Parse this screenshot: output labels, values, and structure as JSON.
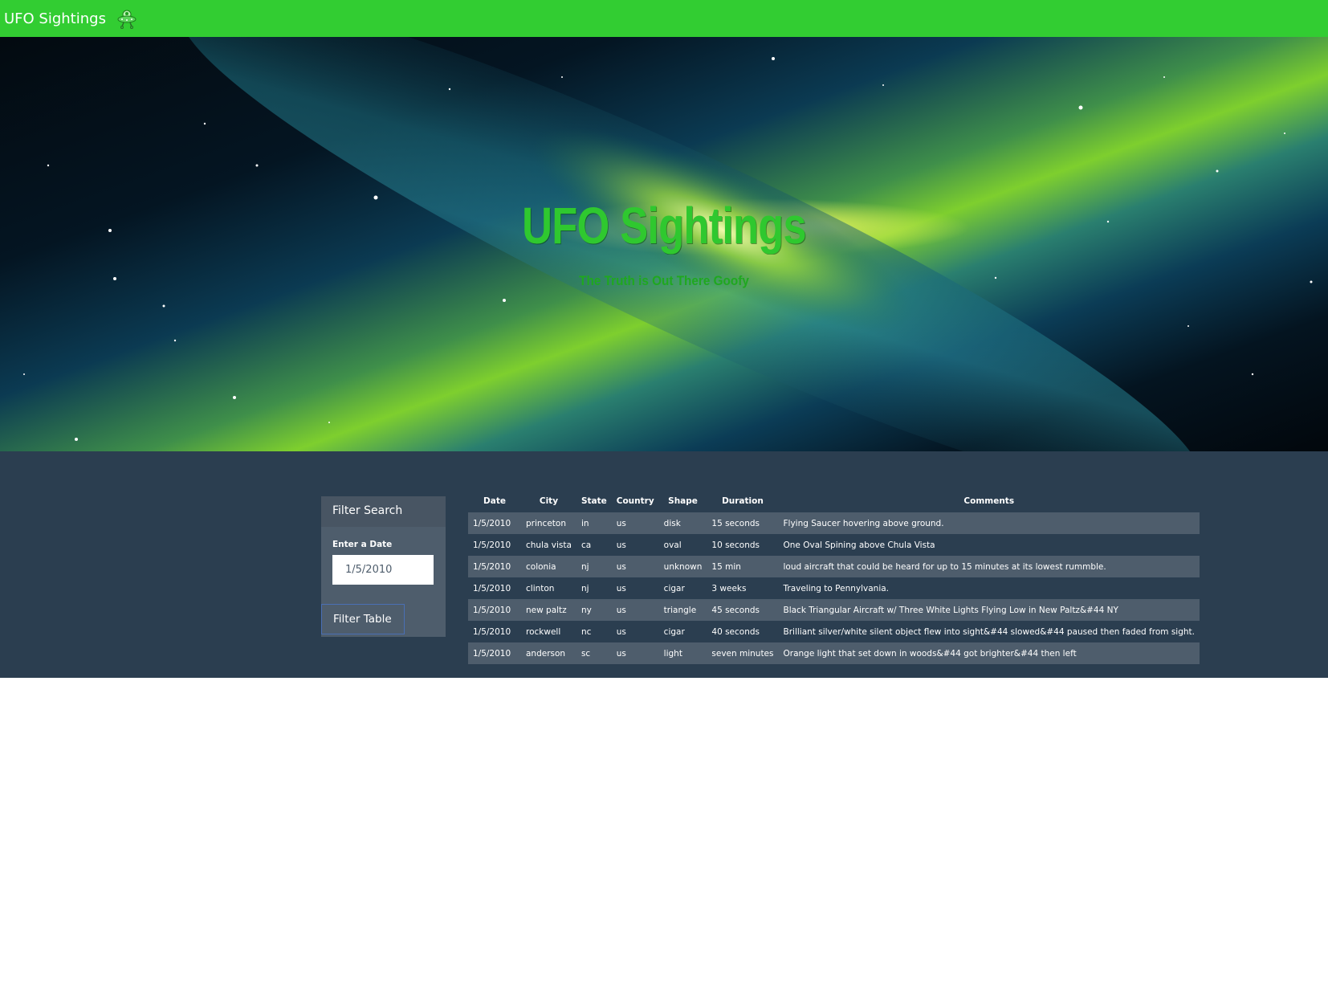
{
  "navbar": {
    "brand": "UFO Sightings",
    "brand_icon": "ufo-icon"
  },
  "hero": {
    "title": "UFO Sightings",
    "subtitle": "The Truth is Out There Goofy"
  },
  "filter": {
    "heading": "Filter Search",
    "date_label": "Enter a Date",
    "date_value": "1/5/2010",
    "button_label": "Filter Table"
  },
  "table": {
    "headers": [
      "Date",
      "City",
      "State",
      "Country",
      "Shape",
      "Duration",
      "Comments"
    ],
    "rows": [
      [
        "1/5/2010",
        "princeton",
        "in",
        "us",
        "disk",
        "15 seconds",
        "Flying Saucer hovering above ground."
      ],
      [
        "1/5/2010",
        "chula vista",
        "ca",
        "us",
        "oval",
        "10 seconds",
        "One Oval Spining above Chula Vista"
      ],
      [
        "1/5/2010",
        "colonia",
        "nj",
        "us",
        "unknown",
        "15 min",
        "loud aircraft that could be heard for up to 15 minutes at its lowest rummble."
      ],
      [
        "1/5/2010",
        "clinton",
        "nj",
        "us",
        "cigar",
        "3 weeks",
        "Traveling to Pennylvania."
      ],
      [
        "1/5/2010",
        "new paltz",
        "ny",
        "us",
        "triangle",
        "45 seconds",
        "Black Triangular Aircraft w/ Three White Lights Flying Low in New Paltz&#44 NY"
      ],
      [
        "1/5/2010",
        "rockwell",
        "nc",
        "us",
        "cigar",
        "40 seconds",
        "Brilliant silver/white silent object flew into sight&#44 slowed&#44 paused then faded from sight."
      ],
      [
        "1/5/2010",
        "anderson",
        "sc",
        "us",
        "light",
        "seven minutes",
        "Orange light that set down in woods&#44 got brighter&#44 then left"
      ]
    ]
  },
  "colors": {
    "navbar": "#32cd32",
    "content_bg": "#2b3e50",
    "panel_bg": "#4e5d6c",
    "hero_title": "#2fc82f"
  }
}
